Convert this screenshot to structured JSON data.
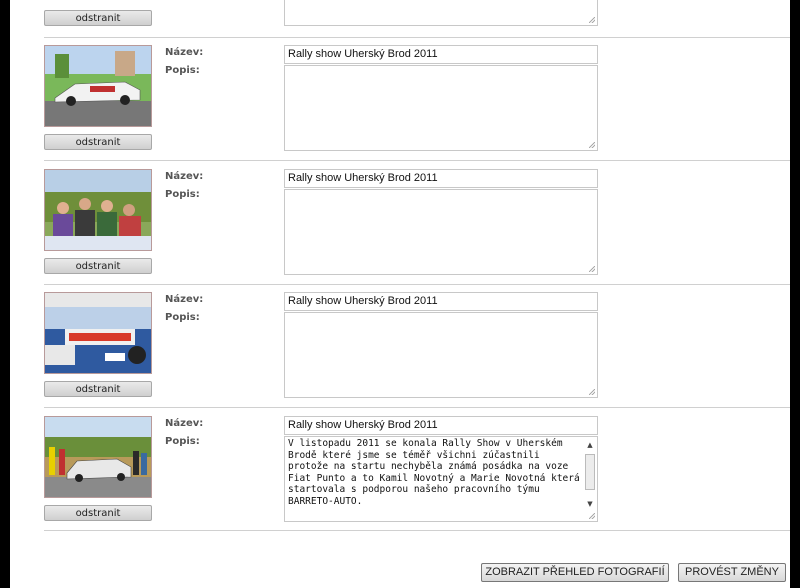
{
  "labels": {
    "name": "Název:",
    "description": "Popis:",
    "remove": "odstranit"
  },
  "photos": [
    {
      "name": "Rally show Uherský Brod 2011",
      "description": ""
    },
    {
      "name": "Rally show Uherský Brod 2011",
      "description": ""
    },
    {
      "name": "Rally show Uherský Brod 2011",
      "description": ""
    },
    {
      "name": "Rally show Uherský Brod 2011",
      "description": "V listopadu 2011 se konala Rally Show v Uherském Brodě které jsme se téměř všichni zúčastnili protože na startu nechyběla známá posádka na voze Fiat Punto a to Kamil Novotný a Marie Novotná která startovala s podporou našeho pracovního týmu BARRETO-AUTO."
    }
  ],
  "actions": {
    "overview": "ZOBRAZIT PŘEHLED FOTOGRAFIÍ",
    "save": "PROVÉST ZMĚNY"
  }
}
